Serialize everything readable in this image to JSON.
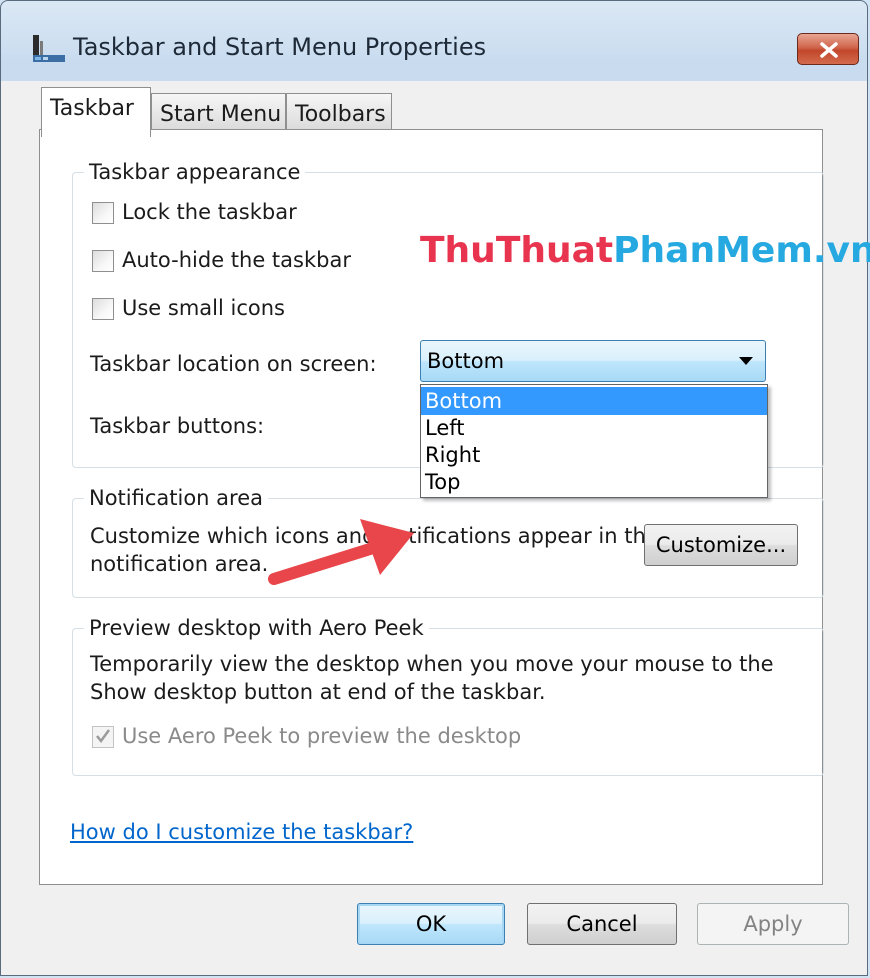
{
  "window": {
    "title": "Taskbar and Start Menu Properties"
  },
  "tabs": [
    {
      "label": "Taskbar",
      "active": true
    },
    {
      "label": "Start Menu",
      "active": false
    },
    {
      "label": "Toolbars",
      "active": false
    }
  ],
  "watermark": {
    "part1": "ThuThuat",
    "part2": "PhanMem.vn",
    "color1": "#e8344e",
    "color2": "#26a9e0"
  },
  "appearance": {
    "title": "Taskbar appearance",
    "lock_label": "Lock the taskbar",
    "lock_checked": false,
    "autohide_label": "Auto-hide the taskbar",
    "autohide_checked": false,
    "small_icons_label": "Use small icons",
    "small_icons_checked": false,
    "location_label": "Taskbar location on screen:",
    "location_value": "Bottom",
    "location_options": [
      "Bottom",
      "Left",
      "Right",
      "Top"
    ],
    "buttons_label": "Taskbar buttons:"
  },
  "notification": {
    "title": "Notification area",
    "desc_line1": "Customize which icons and notifications appear in the",
    "desc_line2": "notification area.",
    "customize_button": "Customize..."
  },
  "aero": {
    "title": "Preview desktop with Aero Peek",
    "desc_line1": "Temporarily view the desktop when you move your mouse to the",
    "desc_line2": "Show desktop button at end of the taskbar.",
    "checkbox_label": "Use Aero Peek to preview the desktop",
    "checkbox_checked": true,
    "checkbox_disabled": true
  },
  "help_link": "How do I customize the taskbar?",
  "footer": {
    "ok": "OK",
    "cancel": "Cancel",
    "apply": "Apply"
  },
  "colors": {
    "accent_blue": "#3399ff",
    "link": "#0066cc",
    "annotation_arrow": "#e8464a"
  }
}
